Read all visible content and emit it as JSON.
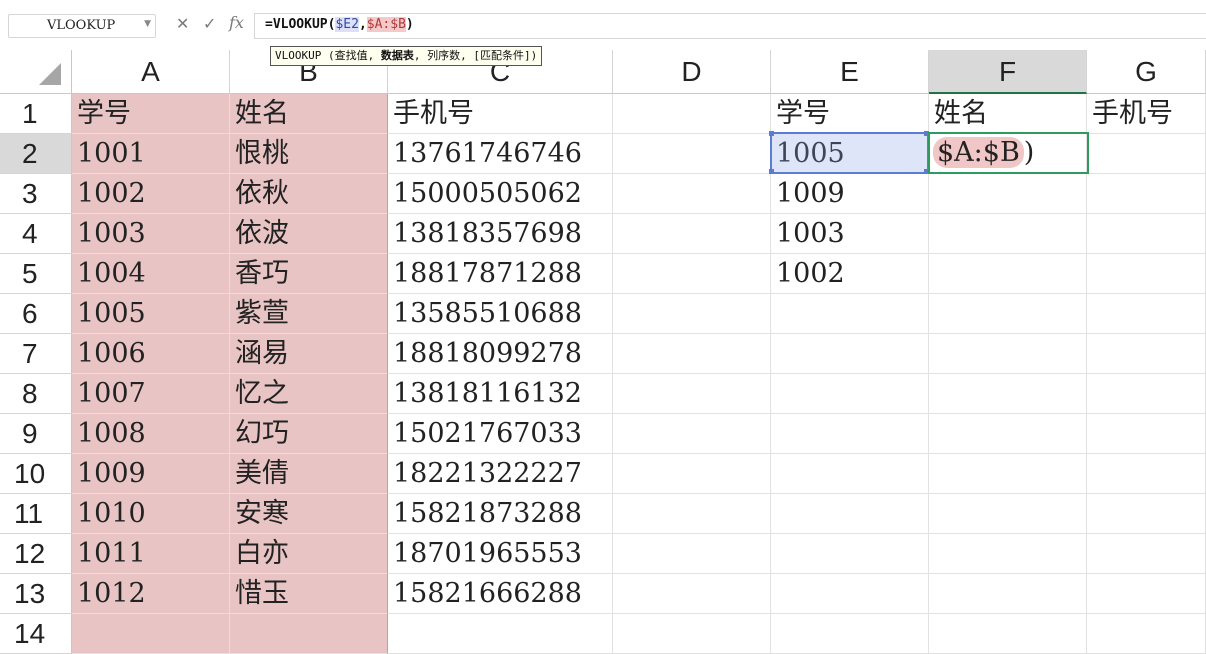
{
  "formula_bar": {
    "name_box": "VLOOKUP",
    "cancel_icon": "close-icon",
    "enter_icon": "check-icon",
    "fx_label": "fx",
    "formula_prefix": "=VLOOKUP(",
    "formula_ref1": "$E2",
    "formula_comma": ",",
    "formula_ref2": "$A:$B",
    "formula_suffix": ")"
  },
  "tooltip": {
    "func": "VLOOKUP",
    "open": " (查找值, ",
    "bold_arg": "数据表",
    "rest": ", 列序数, [匹配条件])"
  },
  "columns": [
    "A",
    "B",
    "C",
    "D",
    "E",
    "F",
    "G"
  ],
  "active_column": "F",
  "rows": [
    "1",
    "2",
    "3",
    "4",
    "5",
    "6",
    "7",
    "8",
    "9",
    "10",
    "11",
    "12",
    "13",
    "14"
  ],
  "active_row": "2",
  "table_main": {
    "headers": [
      "学号",
      "姓名",
      "手机号"
    ],
    "records": [
      [
        "1001",
        "恨桃",
        "13761746746"
      ],
      [
        "1002",
        "依秋",
        "15000505062"
      ],
      [
        "1003",
        "依波",
        "13818357698"
      ],
      [
        "1004",
        "香巧",
        "18817871288"
      ],
      [
        "1005",
        "紫萱",
        "13585510688"
      ],
      [
        "1006",
        "涵易",
        "18818099278"
      ],
      [
        "1007",
        "忆之",
        "13818116132"
      ],
      [
        "1008",
        "幻巧",
        "15021767033"
      ],
      [
        "1009",
        "美倩",
        "18221322227"
      ],
      [
        "1010",
        "安寒",
        "15821873288"
      ],
      [
        "1011",
        "白亦",
        "18701965553"
      ],
      [
        "1012",
        "惜玉",
        "15821666288"
      ]
    ]
  },
  "table_lookup": {
    "headers": [
      "学号",
      "姓名",
      "手机号"
    ],
    "ids": [
      "1005",
      "1009",
      "1003",
      "1002"
    ]
  },
  "editing_cell": {
    "ref_text": "$A:$B",
    "suffix": ")"
  },
  "colors": {
    "highlight_range": "#e9c4c4",
    "ref_blue": "#5b7bd5",
    "edit_green": "#2e9a5e"
  }
}
